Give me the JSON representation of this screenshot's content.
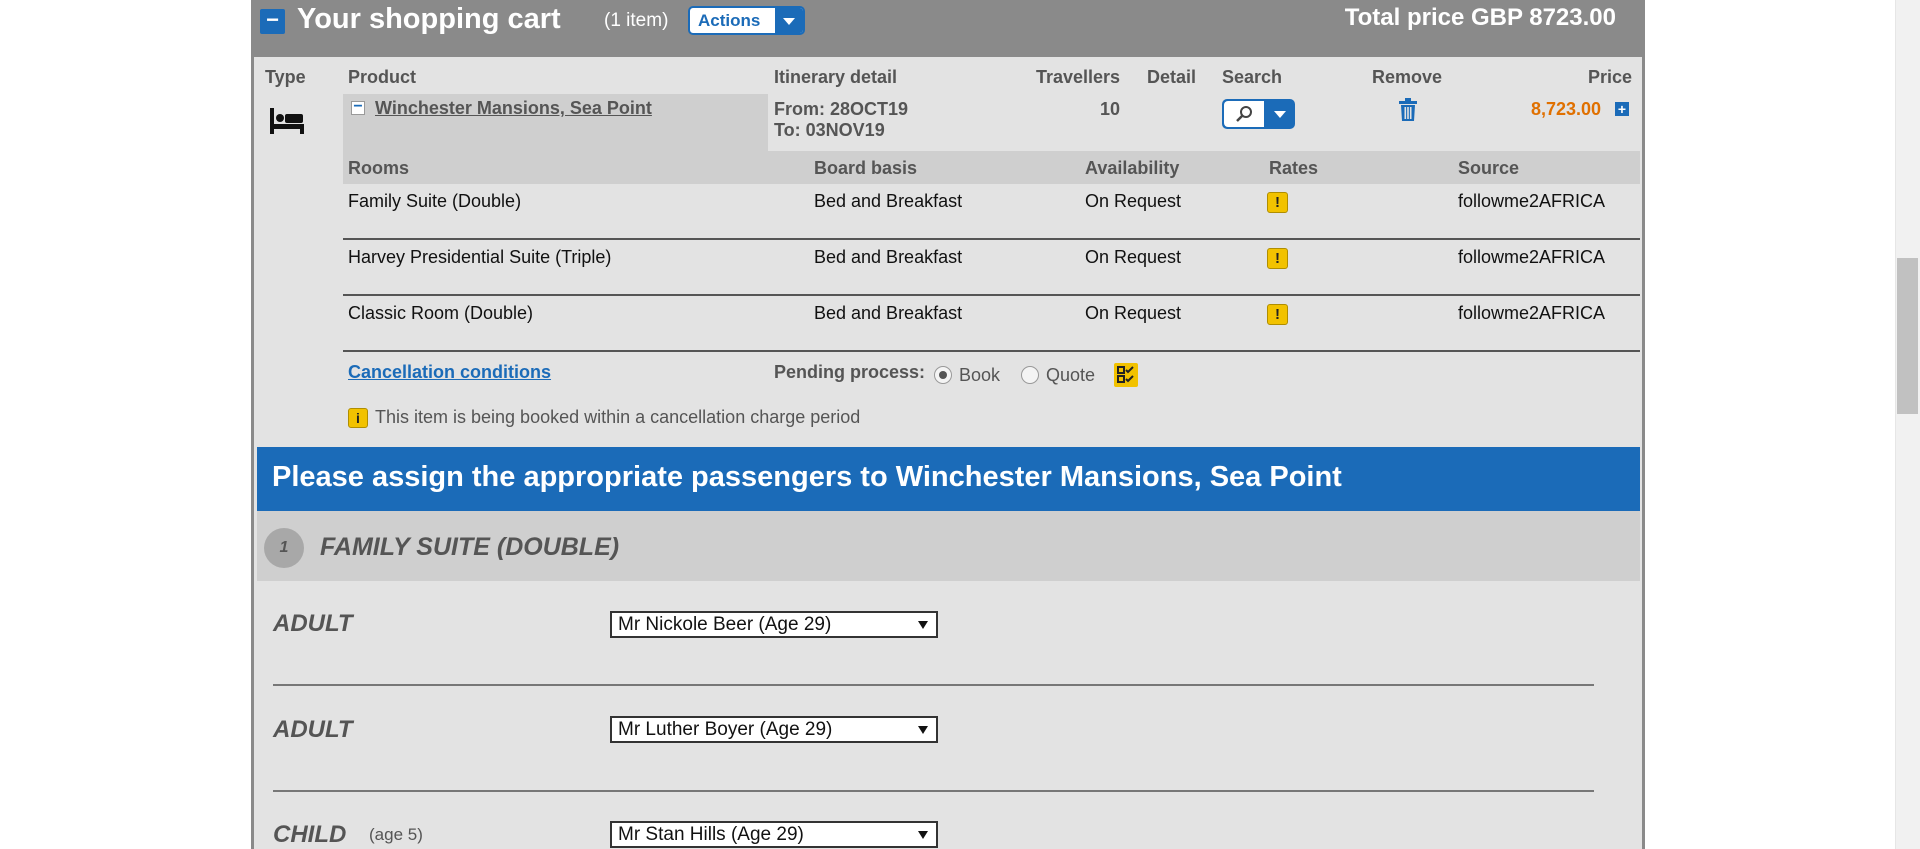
{
  "cart": {
    "title": "Your shopping cart",
    "item_count": "(1 item)",
    "actions_label": "Actions",
    "total_price": "Total price GBP 8723.00"
  },
  "columns": {
    "type": "Type",
    "product": "Product",
    "itinerary": "Itinerary detail",
    "travellers": "Travellers",
    "detail": "Detail",
    "search": "Search",
    "remove": "Remove",
    "price": "Price"
  },
  "item": {
    "product_name": "Winchester Mansions, Sea Point",
    "from": "From: 28OCT19",
    "to": "To: 03NOV19",
    "travellers": "10",
    "price": "8,723.00"
  },
  "rooms_table": {
    "headers": {
      "rooms": "Rooms",
      "board": "Board basis",
      "availability": "Availability",
      "rates": "Rates",
      "source": "Source"
    },
    "rows": [
      {
        "room": "Family Suite (Double)",
        "board": "Bed and Breakfast",
        "availability": "On Request",
        "rate_icon": "!",
        "source": "followme2AFRICA"
      },
      {
        "room": "Harvey Presidential Suite (Triple)",
        "board": "Bed and Breakfast",
        "availability": "On Request",
        "rate_icon": "!",
        "source": "followme2AFRICA"
      },
      {
        "room": "Classic Room (Double)",
        "board": "Bed and Breakfast",
        "availability": "On Request",
        "rate_icon": "!",
        "source": "followme2AFRICA"
      }
    ]
  },
  "cancellation_link": "Cancellation conditions",
  "pending": {
    "label": "Pending process:",
    "options": [
      "Book",
      "Quote"
    ],
    "selected": "Book"
  },
  "info_icon": "i",
  "info_text": "This item is being booked within a cancellation charge period",
  "assign": {
    "title": "Please assign the appropriate passengers to Winchester Mansions, Sea Point",
    "room_number": "1",
    "room_name": "FAMILY SUITE (DOUBLE)",
    "passengers": [
      {
        "type": "ADULT",
        "age_note": "",
        "selected": "Mr Nickole Beer (Age 29)"
      },
      {
        "type": "ADULT",
        "age_note": "",
        "selected": "Mr Luther Boyer (Age 29)"
      },
      {
        "type": "CHILD",
        "age_note": "(age 5)",
        "selected": "Mr Stan Hills (Age 29)"
      }
    ]
  },
  "icons": {
    "collapse": "minus-icon",
    "bed": "bed-icon",
    "search": "magnifier-icon",
    "trash": "trash-icon",
    "expand": "plus-icon",
    "warning": "warning-icon",
    "process": "checklist-icon",
    "info": "info-icon"
  },
  "colors": {
    "header_bg": "#8a8a8a",
    "accent_blue": "#1b6bb8",
    "price_orange": "#e07000",
    "warning_yellow": "#f2c200",
    "panel_bg": "#e3e3e3"
  }
}
